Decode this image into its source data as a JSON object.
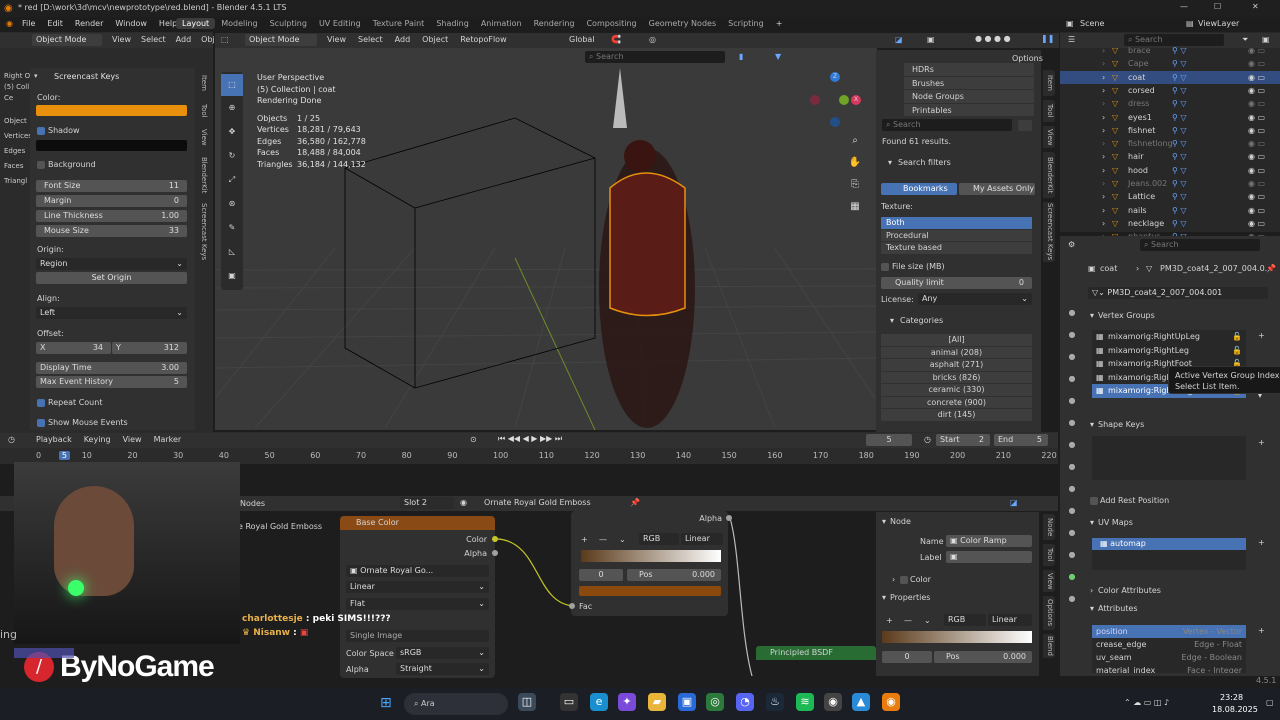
{
  "titlebar": {
    "title": "* red [D:\\work\\3d\\mcv\\newprototype\\red.blend] - Blender 4.5.1 LTS",
    "minimize": "—",
    "maximize": "☐",
    "close": "✕"
  },
  "menu": {
    "items": [
      "File",
      "Edit",
      "Render",
      "Window",
      "Help"
    ],
    "workspaces": [
      "Layout",
      "Modeling",
      "Sculpting",
      "UV Editing",
      "Texture Paint",
      "Shading",
      "Animation",
      "Rendering",
      "Compositing",
      "Geometry Nodes",
      "Scripting"
    ],
    "active_workspace": "Layout",
    "add": "+",
    "scene": "Scene",
    "viewlayer": "ViewLayer"
  },
  "left_header": {
    "mode": "Object Mode",
    "items": [
      "View",
      "Select",
      "Add",
      "Obje"
    ]
  },
  "left_info": {
    "lines": [
      "Right O",
      "(5) Coll",
      "Ce",
      "Object",
      "Vertices",
      "Edges",
      "Faces",
      "Triangl"
    ]
  },
  "screencast": {
    "title": "Screencast Keys",
    "color_label": "Color:",
    "shadow_label": "Shadow",
    "background_label": "Background",
    "color_value": "#e8900c",
    "props": [
      {
        "label": "Font Size",
        "value": "11"
      },
      {
        "label": "Margin",
        "value": "0"
      },
      {
        "label": "Line Thickness",
        "value": "1.00"
      },
      {
        "label": "Mouse Size",
        "value": "33"
      }
    ],
    "origin_label": "Origin:",
    "origin_value": "Region",
    "set_origin": "Set Origin",
    "align_label": "Align:",
    "align_value": "Left",
    "offset_label": "Offset:",
    "offset_x_label": "X",
    "offset_x": "34",
    "offset_y_label": "Y",
    "offset_y": "312",
    "display_time_label": "Display Time",
    "display_time": "3.00",
    "max_history_label": "Max Event History",
    "max_history": "5",
    "repeat_count": "Repeat Count",
    "show_mouse": "Show Mouse Events"
  },
  "side_tabs": [
    "Item",
    "Tool",
    "View",
    "BlenderKit",
    "Screencast Keys"
  ],
  "viewport": {
    "mode": "Object Mode",
    "menus": [
      "View",
      "Select",
      "Add",
      "Object",
      "RetopoFlow"
    ],
    "orientation": "Global",
    "search_placeholder": "Search",
    "options": "Options",
    "overlay": {
      "lines": [
        "User Perspective",
        "(5) Collection | coat",
        "Rendering Done"
      ],
      "stats": [
        {
          "label": "Objects",
          "value": "1 / 25"
        },
        {
          "label": "Vertices",
          "value": "18,281 / 79,643"
        },
        {
          "label": "Edges",
          "value": "36,580 / 162,778"
        },
        {
          "label": "Faces",
          "value": "18,488 / 84,004"
        },
        {
          "label": "Triangles",
          "value": "36,184 / 144,132"
        }
      ]
    }
  },
  "blenderkit": {
    "list": [
      "HDRs",
      "Brushes",
      "Node Groups",
      "Printables"
    ],
    "search_placeholder": "Search",
    "found": "Found 61 results.",
    "search_filters": "Search filters",
    "bookmarks": "Bookmarks",
    "my_assets": "My Assets Only",
    "texture_label": "Texture:",
    "texture_options": [
      "Both",
      "Procedural",
      "Texture based"
    ],
    "file_size": "File size (MB)",
    "quality_label": "Quality limit",
    "quality_value": "0",
    "license_label": "License:",
    "license_value": "Any",
    "categories_label": "Categories",
    "categories": [
      "[All]",
      "animal (208)",
      "asphalt (271)",
      "bricks (826)",
      "ceramic (330)",
      "concrete (900)",
      "dirt (145)"
    ]
  },
  "timeline": {
    "menus": [
      "Playback",
      "Keying",
      "View",
      "Marker"
    ],
    "current_frame": "5",
    "start_label": "Start",
    "start": "2",
    "end_label": "End",
    "end": "5",
    "ticks": [
      "0",
      "5",
      "10",
      "20",
      "30",
      "40",
      "50",
      "60",
      "70",
      "80",
      "90",
      "100",
      "110",
      "120",
      "130",
      "140",
      "150",
      "160",
      "170",
      "180",
      "190",
      "200",
      "210",
      "220"
    ]
  },
  "node_editor": {
    "header_label": "Nodes",
    "slot": "Slot 2",
    "material": "Ornate Royal Gold Emboss",
    "left_label": "e Royal Gold Emboss",
    "base_color_node": {
      "title": "Base Color",
      "out_color": "Color",
      "out_alpha": "Alpha",
      "image": "Ornate Royal Go...",
      "interp": "Linear",
      "proj": "Flat",
      "source": "Single Image",
      "cs_label": "Color Space",
      "cs_value": "sRGB",
      "alpha_label": "Alpha",
      "alpha_value": "Straight"
    },
    "ramp_node": {
      "alpha": "Alpha",
      "mode": "RGB",
      "interp": "Linear",
      "index": "0",
      "pos_label": "Pos",
      "pos": "0.000",
      "fac": "Fac"
    },
    "principled": "Principled BSDF"
  },
  "chat": {
    "lines": [
      {
        "user": "charlottesje",
        "text": "peki SIMS!!!???"
      },
      {
        "user": "Nisanw",
        "text": ""
      }
    ],
    "brand": "ByNoGame",
    "left_text": "ing"
  },
  "node_side": {
    "node_label": "Node",
    "name_label": "Name",
    "name_value": "Color Ramp",
    "label_label": "Label",
    "color_label": "Color",
    "properties": "Properties",
    "mode": "RGB",
    "interp": "Linear",
    "index": "0",
    "pos_label": "Pos",
    "pos": "0.000",
    "tabs": [
      "Node",
      "Tool",
      "View",
      "Options",
      "Blend"
    ]
  },
  "outliner": {
    "search_placeholder": "Search",
    "items": [
      {
        "name": "brace",
        "sel": false,
        "dim": true
      },
      {
        "name": "Cape",
        "sel": false,
        "dim": true
      },
      {
        "name": "coat",
        "sel": true,
        "dim": false
      },
      {
        "name": "corsed",
        "sel": false,
        "dim": false
      },
      {
        "name": "dress",
        "sel": false,
        "dim": true
      },
      {
        "name": "eyes1",
        "sel": false,
        "dim": false
      },
      {
        "name": "fishnet",
        "sel": false,
        "dim": false
      },
      {
        "name": "fishnetlong",
        "sel": false,
        "dim": true
      },
      {
        "name": "hair",
        "sel": false,
        "dim": false
      },
      {
        "name": "hood",
        "sel": false,
        "dim": false
      },
      {
        "name": "Jeans.002",
        "sel": false,
        "dim": true
      },
      {
        "name": "Lattice",
        "sel": false,
        "dim": false
      },
      {
        "name": "nails",
        "sel": false,
        "dim": false
      },
      {
        "name": "necklage",
        "sel": false,
        "dim": false
      },
      {
        "name": "phantus",
        "sel": false,
        "dim": true
      }
    ]
  },
  "properties": {
    "search_placeholder": "Search",
    "object": "coat",
    "mesh": "PM3D_coat4_2_007_004.0...",
    "mesh_data": "PM3D_coat4_2_007_004.001",
    "vertex_groups_label": "Vertex Groups",
    "vertex_groups": [
      "mixamorig:RightUpLeg",
      "mixamorig:RightLeg",
      "mixamorig:RightFoot",
      "mixamorig:RightToeBase",
      "mixamorig:RightToe_End"
    ],
    "tooltip": [
      "Active Vertex Group Index",
      "Select List Item."
    ],
    "shape_keys": "Shape Keys",
    "add_rest": "Add Rest Position",
    "uv_maps": "UV Maps",
    "uv_map": "automap",
    "color_attributes": "Color Attributes",
    "attributes": "Attributes",
    "attr_list": [
      {
        "name": "position",
        "info": "Vertex - Vector"
      },
      {
        "name": "crease_edge",
        "info": "Edge - Float"
      },
      {
        "name": "uv_seam",
        "info": "Edge - Boolean"
      },
      {
        "name": "material_index",
        "info": "Face - Integer"
      }
    ],
    "version": "4.5.1"
  },
  "taskbar": {
    "search": "Ara",
    "time": "23:28",
    "date": "18.08.2025"
  }
}
